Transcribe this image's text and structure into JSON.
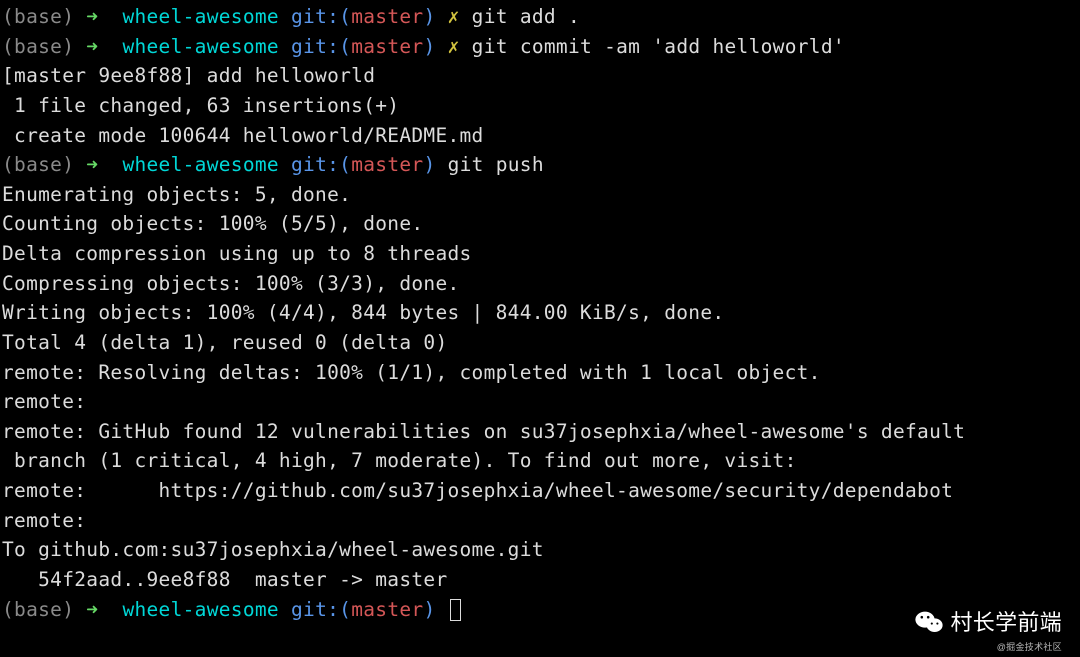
{
  "prompt1": {
    "base": "(base)",
    "arrow": "➜ ",
    "dir": "wheel-awesome",
    "git_label": "git:(",
    "branch": "master",
    "git_close": ")",
    "dirty": "✗",
    "cmd": "git add ."
  },
  "prompt2": {
    "base": "(base)",
    "arrow": "➜ ",
    "dir": "wheel-awesome",
    "git_label": "git:(",
    "branch": "master",
    "git_close": ")",
    "dirty": "✗",
    "cmd": "git commit -am 'add helloworld'"
  },
  "commit_out": {
    "line1": "[master 9ee8f88] add helloworld",
    "line2": " 1 file changed, 63 insertions(+)",
    "line3": " create mode 100644 helloworld/README.md"
  },
  "prompt3": {
    "base": "(base)",
    "arrow": "➜ ",
    "dir": "wheel-awesome",
    "git_label": "git:(",
    "branch": "master",
    "git_close": ")",
    "cmd": "git push"
  },
  "push_out": {
    "l1": "Enumerating objects: 5, done.",
    "l2": "Counting objects: 100% (5/5), done.",
    "l3": "Delta compression using up to 8 threads",
    "l4": "Compressing objects: 100% (3/3), done.",
    "l5": "Writing objects: 100% (4/4), 844 bytes | 844.00 KiB/s, done.",
    "l6": "Total 4 (delta 1), reused 0 (delta 0)",
    "l7": "remote: Resolving deltas: 100% (1/1), completed with 1 local object.",
    "l8": "remote:",
    "l9": "remote: GitHub found 12 vulnerabilities on su37josephxia/wheel-awesome's default",
    "l10": " branch (1 critical, 4 high, 7 moderate). To find out more, visit:",
    "l11": "remote:      https://github.com/su37josephxia/wheel-awesome/security/dependabot",
    "l12": "remote:",
    "l13": "To github.com:su37josephxia/wheel-awesome.git",
    "l14": "   54f2aad..9ee8f88  master -> master"
  },
  "prompt4": {
    "base": "(base)",
    "arrow": "➜ ",
    "dir": "wheel-awesome",
    "git_label": "git:(",
    "branch": "master",
    "git_close": ")"
  },
  "watermark": {
    "text": "村长学前端",
    "sub": "@掘金技术社区"
  }
}
